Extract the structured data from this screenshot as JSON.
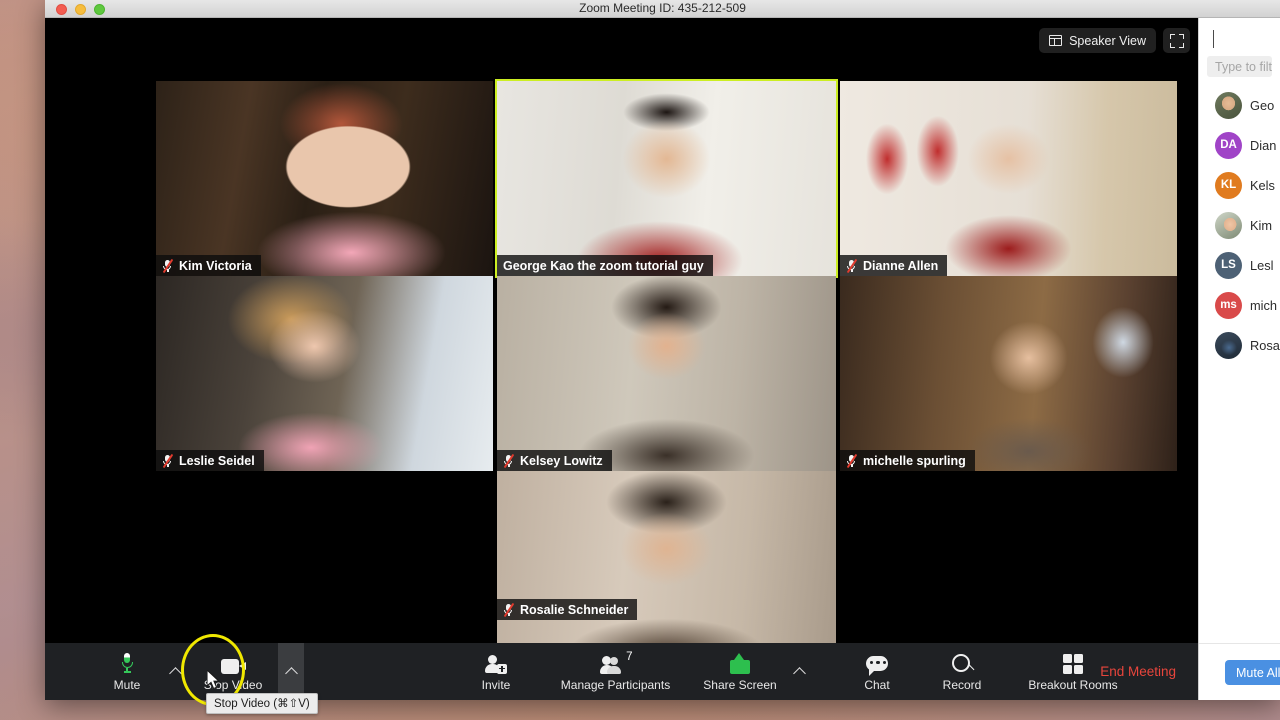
{
  "window": {
    "title": "Zoom Meeting ID: 435-212-509",
    "traffic_lights": [
      "close",
      "minimize",
      "zoom"
    ]
  },
  "view_controls": {
    "speaker_view_label": "Speaker View",
    "grid_icon": "layout-grid-icon",
    "fullscreen_icon": "enter-fullscreen-icon"
  },
  "gallery": {
    "active_speaker_border_color": "#ccee22",
    "tiles": [
      {
        "name": "Kim Victoria",
        "muted": true,
        "active_speaker": false
      },
      {
        "name": "George Kao the zoom tutorial guy",
        "muted": false,
        "active_speaker": true
      },
      {
        "name": "Dianne Allen",
        "muted": true,
        "active_speaker": false
      },
      {
        "name": "Leslie Seidel",
        "muted": true,
        "active_speaker": false
      },
      {
        "name": "Kelsey Lowitz",
        "muted": true,
        "active_speaker": false
      },
      {
        "name": "michelle spurling",
        "muted": true,
        "active_speaker": false
      },
      {
        "name": "Rosalie Schneider",
        "muted": true,
        "active_speaker": false
      }
    ]
  },
  "participants_panel": {
    "collapse_icon": "chevron-down-icon",
    "filter_placeholder": "Type to filter",
    "mute_all_label": "Mute All",
    "mute_all_color": "#4a90e2",
    "participants": [
      {
        "name": "George Kao the zoom tutorial guy",
        "display": "Geo",
        "avatar_type": "photo",
        "initials": ""
      },
      {
        "name": "Dianne Allen",
        "display": "Dian",
        "avatar_type": "initials",
        "initials": "DA",
        "color": "#a044c7"
      },
      {
        "name": "Kelsey Lowitz",
        "display": "Kels",
        "avatar_type": "initials",
        "initials": "KL",
        "color": "#e07b1f"
      },
      {
        "name": "Kim Victoria",
        "display": "Kim",
        "avatar_type": "photo",
        "initials": ""
      },
      {
        "name": "Leslie Seidel",
        "display": "Lesl",
        "avatar_type": "initials",
        "initials": "LS",
        "color": "#4d6175"
      },
      {
        "name": "michelle spurling",
        "display": "mich",
        "avatar_type": "initials",
        "initials": "ms",
        "color": "#d94a4a"
      },
      {
        "name": "Rosalie Schneider",
        "display": "Rosa",
        "avatar_type": "photo",
        "initials": ""
      }
    ]
  },
  "toolbar": {
    "mute_label": "Mute",
    "mute_icon": "microphone-icon",
    "mute_caret_icon": "chevron-up-icon",
    "stop_video_label": "Stop Video",
    "stop_video_icon": "video-camera-icon",
    "stop_video_caret_icon": "chevron-up-icon",
    "invite_label": "Invite",
    "invite_icon": "person-add-icon",
    "manage_participants_label": "Manage Participants",
    "manage_participants_icon": "people-icon",
    "participant_count": "7",
    "share_screen_label": "Share Screen",
    "share_screen_icon": "share-screen-icon",
    "share_screen_caret_icon": "chevron-up-icon",
    "chat_label": "Chat",
    "chat_icon": "chat-bubble-icon",
    "record_label": "Record",
    "record_icon": "record-circle-icon",
    "breakout_rooms_label": "Breakout Rooms",
    "breakout_rooms_icon": "breakout-grid-icon",
    "end_meeting_label": "End Meeting",
    "end_meeting_color": "#e8453c"
  },
  "annotation": {
    "tooltip_text": "Stop Video (⌘⇧V)",
    "highlight_color": "#f0e800",
    "cursor_icon": "mouse-pointer-icon"
  }
}
